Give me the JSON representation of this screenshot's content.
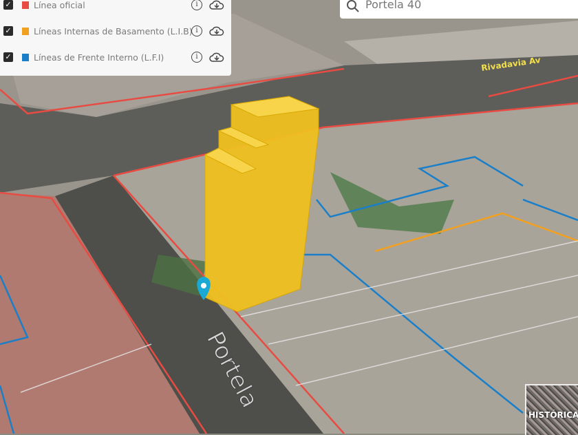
{
  "layers": [
    {
      "label": "Línea oficial",
      "checked": true,
      "color": "#e84b42"
    },
    {
      "label": "Líneas Internas de Basamento (L.I.B)",
      "checked": true,
      "color": "#f2a020"
    },
    {
      "label": "Líneas de Frente Interno (L.F.I)",
      "checked": true,
      "color": "#1a7fc8"
    }
  ],
  "search": {
    "value": "Portela 40"
  },
  "map": {
    "street_labels": {
      "portela": "Portela",
      "rivadavia": "Rivadavia Av"
    },
    "building_color": "#f0c020",
    "marker_color": "#1aa9d4"
  },
  "basemap_toggle": {
    "label": "HISTÓRICA"
  }
}
